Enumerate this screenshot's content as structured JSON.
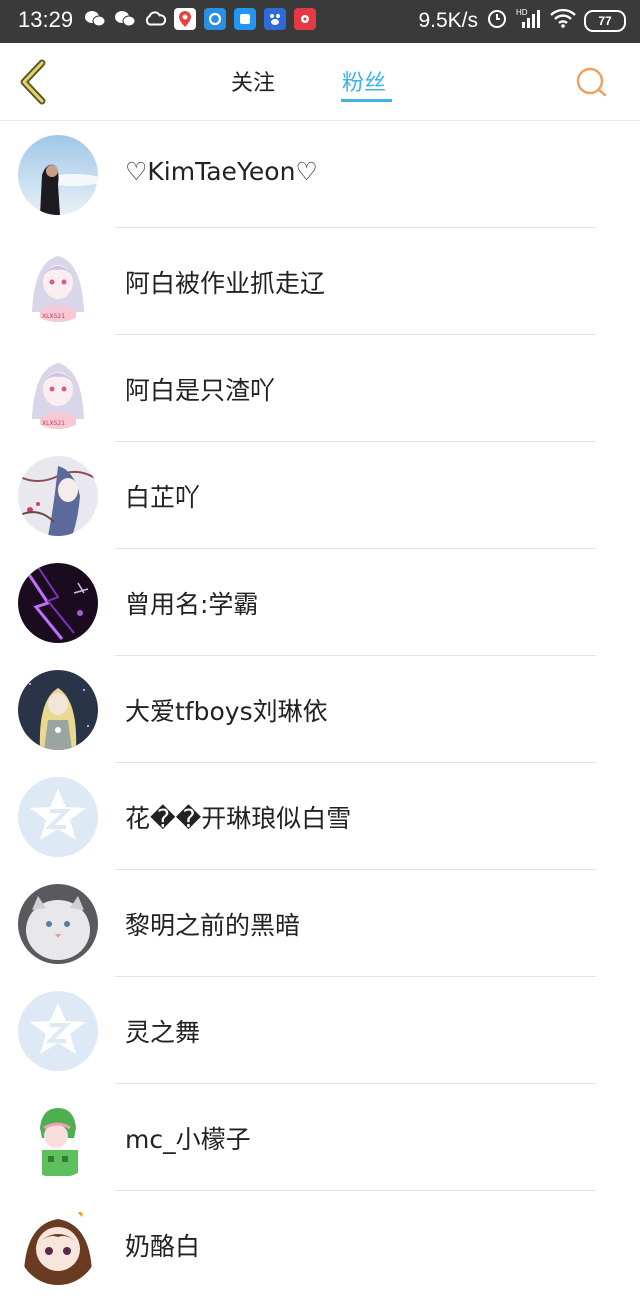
{
  "status_bar": {
    "time": "13:29",
    "network_speed": "9.5K/s",
    "battery": "77",
    "icons": [
      "wechat-icon",
      "wechat-icon",
      "cloud-icon",
      "map-icon",
      "app-icon",
      "app-icon",
      "baidu-icon",
      "music-icon",
      "alarm-icon",
      "signal-icon",
      "wifi-icon",
      "battery-icon"
    ]
  },
  "header": {
    "tabs": [
      "关注",
      "粉丝"
    ],
    "active_tab": "粉丝",
    "accent_color": "#3db4e6",
    "back_icon": "chevron-left-icon",
    "search_icon": "search-icon"
  },
  "fans": [
    {
      "name": "♡KimTaeYeon♡"
    },
    {
      "name": "阿白被作业抓走辽"
    },
    {
      "name": "阿白是只渣吖"
    },
    {
      "name": "白芷吖"
    },
    {
      "name": "曾用名:学霸"
    },
    {
      "name": "大爱tfboys刘琳依"
    },
    {
      "name": "花��开琳琅似白雪"
    },
    {
      "name": "黎明之前的黑暗"
    },
    {
      "name": "灵之舞"
    },
    {
      "name": "mc_小檬子"
    },
    {
      "name": "奶酪白"
    }
  ]
}
